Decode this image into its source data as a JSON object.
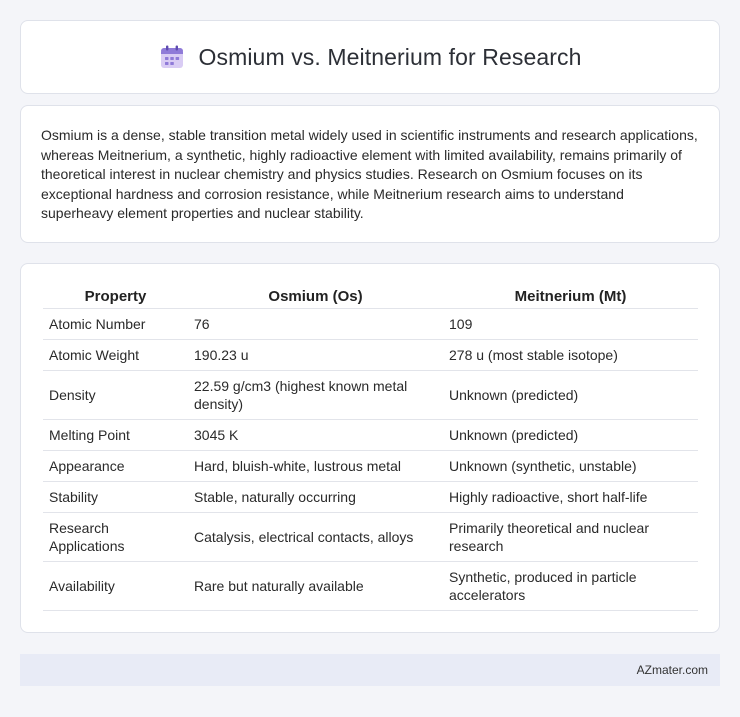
{
  "header": {
    "title": "Osmium vs. Meitnerium for Research",
    "icon": "calendar-icon"
  },
  "description": "Osmium is a dense, stable transition metal widely used in scientific instruments and research applications, whereas Meitnerium, a synthetic, highly radioactive element with limited availability, remains primarily of theoretical interest in nuclear chemistry and physics studies. Research on Osmium focuses on its exceptional hardness and corrosion resistance, while Meitnerium research aims to understand superheavy element properties and nuclear stability.",
  "table": {
    "headers": [
      "Property",
      "Osmium (Os)",
      "Meitnerium (Mt)"
    ],
    "rows": [
      [
        "Atomic Number",
        "76",
        "109"
      ],
      [
        "Atomic Weight",
        "190.23 u",
        "278 u (most stable isotope)"
      ],
      [
        "Density",
        "22.59 g/cm3 (highest known metal density)",
        "Unknown (predicted)"
      ],
      [
        "Melting Point",
        "3045 K",
        "Unknown (predicted)"
      ],
      [
        "Appearance",
        "Hard, bluish-white, lustrous metal",
        "Unknown (synthetic, unstable)"
      ],
      [
        "Stability",
        "Stable, naturally occurring",
        "Highly radioactive, short half-life"
      ],
      [
        "Research Applications",
        "Catalysis, electrical contacts, alloys",
        "Primarily theoretical and nuclear research"
      ],
      [
        "Availability",
        "Rare but naturally available",
        "Synthetic, produced in particle accelerators"
      ]
    ]
  },
  "footer": {
    "brand": "AZmater.com"
  }
}
